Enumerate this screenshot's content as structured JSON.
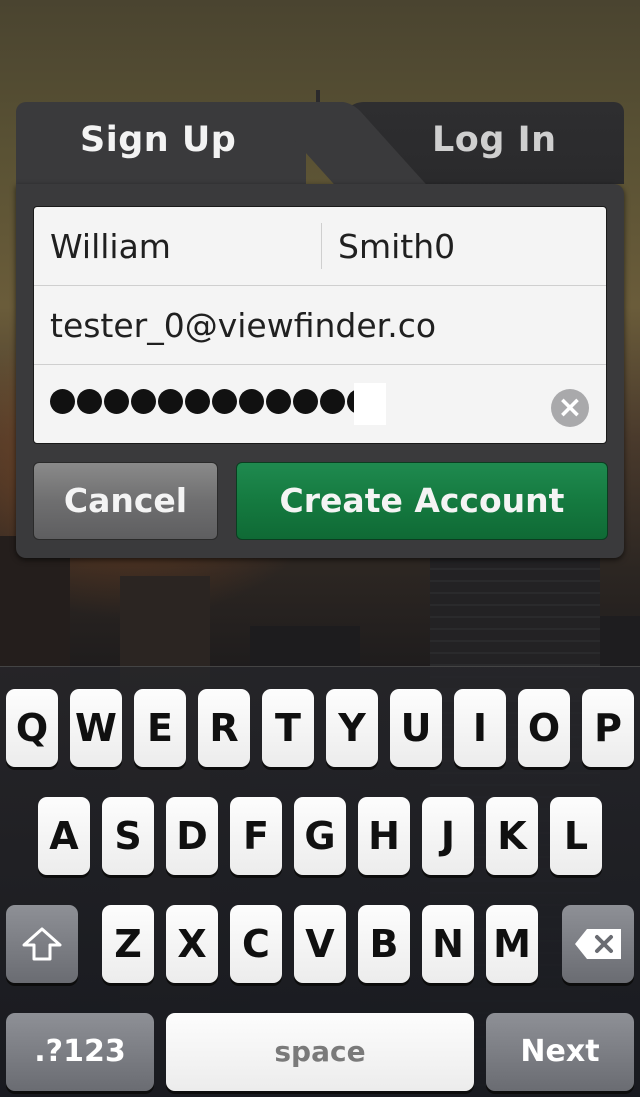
{
  "tabs": {
    "signup": "Sign Up",
    "login": "Log In"
  },
  "form": {
    "first_name": "William",
    "last_name": "Smith0",
    "email": "tester_0@viewfinder.co",
    "password_length": 12
  },
  "buttons": {
    "cancel": "Cancel",
    "create": "Create Account"
  },
  "keyboard": {
    "row1": [
      "Q",
      "W",
      "E",
      "R",
      "T",
      "Y",
      "U",
      "I",
      "O",
      "P"
    ],
    "row2": [
      "A",
      "S",
      "D",
      "F",
      "G",
      "H",
      "J",
      "K",
      "L"
    ],
    "row3": [
      "Z",
      "X",
      "C",
      "V",
      "B",
      "N",
      "M"
    ],
    "numbers_label": ".?123",
    "space_label": "space",
    "next_label": "Next"
  },
  "icons": {
    "shift": "shift-arrow-icon",
    "delete": "backspace-icon",
    "clear": "clear-field-icon"
  }
}
